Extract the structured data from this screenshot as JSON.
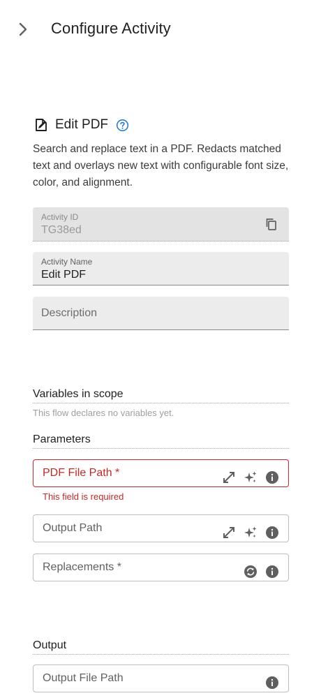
{
  "header": {
    "title": "Configure Activity"
  },
  "activity": {
    "title": "Edit PDF",
    "description": "Search and replace text in a PDF. Redacts matched text and overlays new text with configurable font size, color, and alignment."
  },
  "fields": {
    "activity_id": {
      "label": "Activity ID",
      "value": "TG38ed"
    },
    "activity_name": {
      "label": "Activity Name",
      "value": "Edit PDF"
    },
    "description": {
      "placeholder": "Description"
    }
  },
  "variables": {
    "title": "Variables in scope",
    "empty_text": "This flow declares no variables yet."
  },
  "parameters": {
    "title": "Parameters",
    "pdf_file_path": {
      "placeholder": "PDF File Path *",
      "error": "This field is required"
    },
    "output_path": {
      "placeholder": "Output Path"
    },
    "replacements": {
      "placeholder": "Replacements *"
    }
  },
  "output": {
    "title": "Output",
    "output_file_path": {
      "placeholder": "Output File Path"
    }
  },
  "colors": {
    "error": "#c62828",
    "accent": "#1976d2",
    "icon": "#5f5f5f"
  }
}
